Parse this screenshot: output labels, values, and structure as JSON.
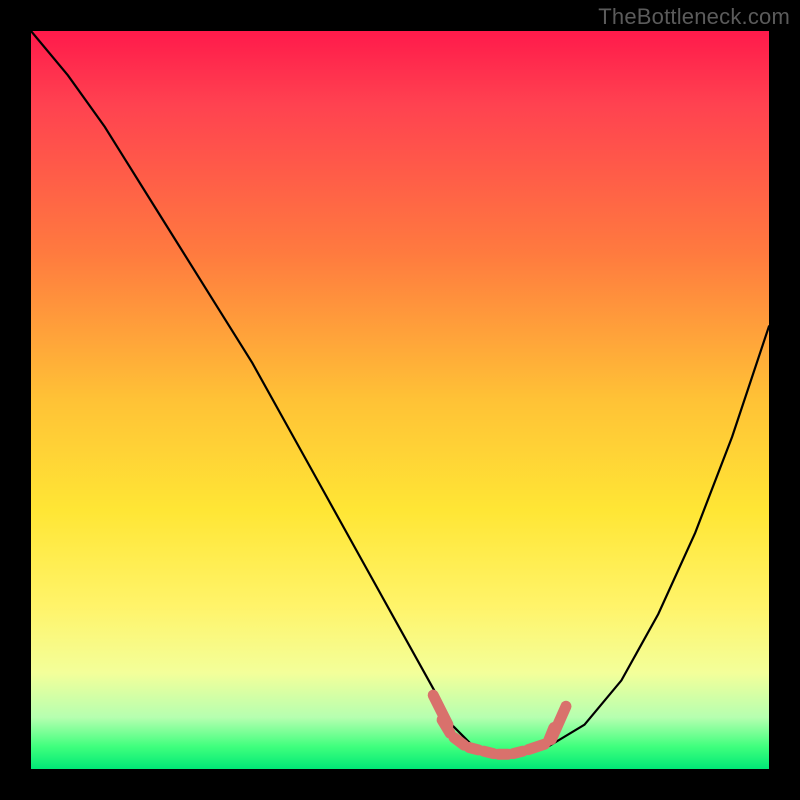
{
  "watermark": "TheBottleneck.com",
  "chart_data": {
    "type": "line",
    "title": "",
    "xlabel": "",
    "ylabel": "",
    "xlim": [
      0,
      100
    ],
    "ylim": [
      0,
      100
    ],
    "x": [
      0,
      5,
      10,
      15,
      20,
      25,
      30,
      35,
      40,
      45,
      50,
      55,
      57,
      60,
      63,
      66,
      70,
      75,
      80,
      85,
      90,
      95,
      100
    ],
    "values": [
      100,
      94,
      87,
      79,
      71,
      63,
      55,
      46,
      37,
      28,
      19,
      10,
      6,
      3,
      2,
      2,
      3,
      6,
      12,
      21,
      32,
      45,
      60
    ],
    "flat_zone_x": [
      57,
      70
    ],
    "markers": {
      "color": "#d9716c",
      "points_x": [
        55.5,
        57,
        59,
        61,
        63,
        65,
        67,
        70,
        71
      ],
      "points_y": [
        7,
        4.5,
        3,
        2.5,
        2,
        2,
        2.5,
        3.5,
        6
      ]
    },
    "background_gradient": [
      "#ff1a4b",
      "#ff7a3f",
      "#ffe635",
      "#b6ffb0",
      "#00e876"
    ]
  }
}
